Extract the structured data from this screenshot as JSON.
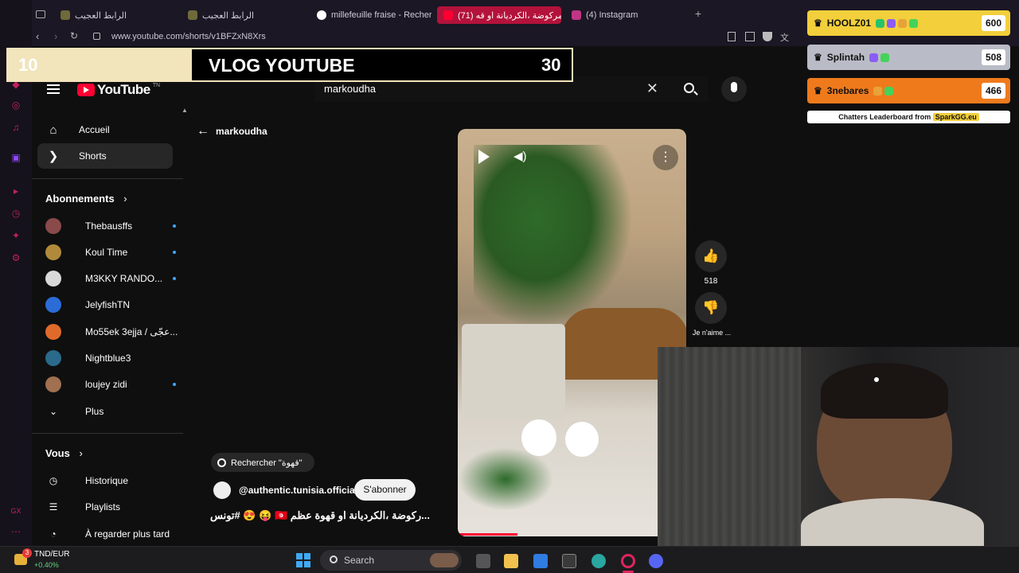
{
  "browser": {
    "tabs": [
      {
        "label": "الرابط العجيب",
        "active": false
      },
      {
        "label": "الرابط العجيب",
        "active": false
      },
      {
        "label": "millefeuille fraise - Recher",
        "active": false
      },
      {
        "label": "المركوضة ،الكرديانة او قه (71)",
        "active": true
      },
      {
        "label": "(4) Instagram",
        "active": false
      }
    ],
    "url": "www.youtube.com/shorts/v1BFZxN8Xrs"
  },
  "overlay": {
    "left_number": "10",
    "title": "VLOG YOUTUBE",
    "right_number": "30"
  },
  "leaderboard": {
    "rows": [
      {
        "name": "HOOLZ01",
        "score": "600",
        "color": "#f2cf3b"
      },
      {
        "name": "Splintah",
        "score": "508",
        "color": "#b9bcc6"
      },
      {
        "name": "3nebares",
        "score": "466",
        "color": "#ef7a1c"
      }
    ],
    "footer_prefix": "Chatters Leaderboard from",
    "footer_brand": "SparkGG.eu"
  },
  "youtube": {
    "logo_text": "YouTube",
    "logo_sup": "TN",
    "search_value": "markoudha",
    "nav": [
      {
        "label": "Accueil",
        "icon": "home-icon"
      },
      {
        "label": "Shorts",
        "icon": "shorts-icon"
      }
    ],
    "subscriptions_title": "Abonnements",
    "subscriptions": [
      {
        "name": "Thebausffs",
        "dot": true,
        "color": "#8a4a4a"
      },
      {
        "name": "Koul Time",
        "dot": true,
        "color": "#b08a3a"
      },
      {
        "name": "M3KKY RANDO...",
        "dot": true,
        "color": "#d9d9d9"
      },
      {
        "name": "JelyfishTN",
        "dot": false,
        "color": "#2b6cd6"
      },
      {
        "name": "Mo55ek 3ejja / عجّى...",
        "dot": false,
        "color": "#e06a2a"
      },
      {
        "name": "Nightblue3",
        "dot": false,
        "color": "#2a6a8a"
      },
      {
        "name": "loujey zidi",
        "dot": true,
        "color": "#a07050"
      }
    ],
    "more_label": "Plus",
    "you_title": "Vous",
    "you_items": [
      {
        "label": "Historique",
        "icon": "history-icon"
      },
      {
        "label": "Playlists",
        "icon": "playlists-icon"
      },
      {
        "label": "À regarder plus tard",
        "icon": "watch-later-icon"
      }
    ],
    "back_label": "markoudha",
    "search_suggest": "Rechercher \"قهوة\"",
    "channel_handle": "@authentic.tunisia.official",
    "subscribe_label": "S'abonner",
    "short_title": "...ركوضة ،الكرديانة او قهوة عظم 🇹🇳 😝 😍 #تونس",
    "like_count": "518",
    "dislike_label": "Je n'aime ..."
  },
  "taskbar": {
    "ticker_name": "TND/EUR",
    "ticker_change": "+0.40%",
    "notif_count": "3",
    "search_label": "Search"
  }
}
